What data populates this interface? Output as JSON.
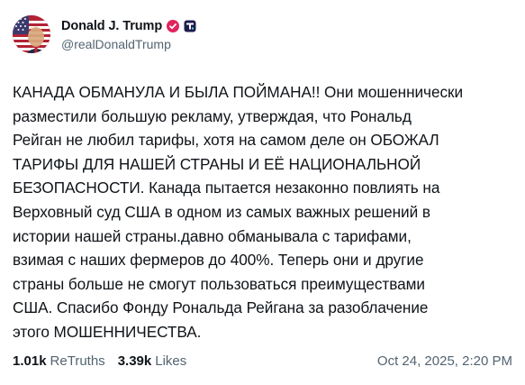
{
  "author": {
    "display_name": "Donald J. Trump",
    "handle": "@realDonaldTrump",
    "avatar_icon": "flag-portrait-avatar",
    "verified_icon": "verified-badge-icon",
    "platform_icon": "truth-social-logo-icon"
  },
  "post": {
    "text": "КАНАДА ОБМАНУЛА И БЫЛА ПОЙМАНА!! Они мошеннически\nразместили большую рекламу, утверждая, что Рональд\nРейган не любил тарифы, хотя на самом деле он ОБОЖАЛ\nТАРИФЫ ДЛЯ НАШЕЙ СТРАНЫ И ЕЁ НАЦИОНАЛЬНОЙ\nБЕЗОПАСНОСТИ. Канада пытается незаконно повлиять на\nВерховный суд США в одном из самых важных решений в\nистории нашей страны.давно обманывала с тарифами,\nвзимая с наших фермеров до 400%. Теперь они и другие\nстраны больше не смогут пользоваться преимуществами\nСША. Спасибо Фонду Рональда Рейгана за разоблачение\nэтого МОШЕННИЧЕСТВА."
  },
  "stats": {
    "retruths_count": "1.01k",
    "retruths_label": "ReTruths",
    "likes_count": "3.39k",
    "likes_label": "Likes"
  },
  "timestamp": "Oct 24, 2025, 2:20 PM",
  "colors": {
    "verified": "#e0245e",
    "secondary_text": "#536471",
    "primary_text": "#0f1419"
  }
}
